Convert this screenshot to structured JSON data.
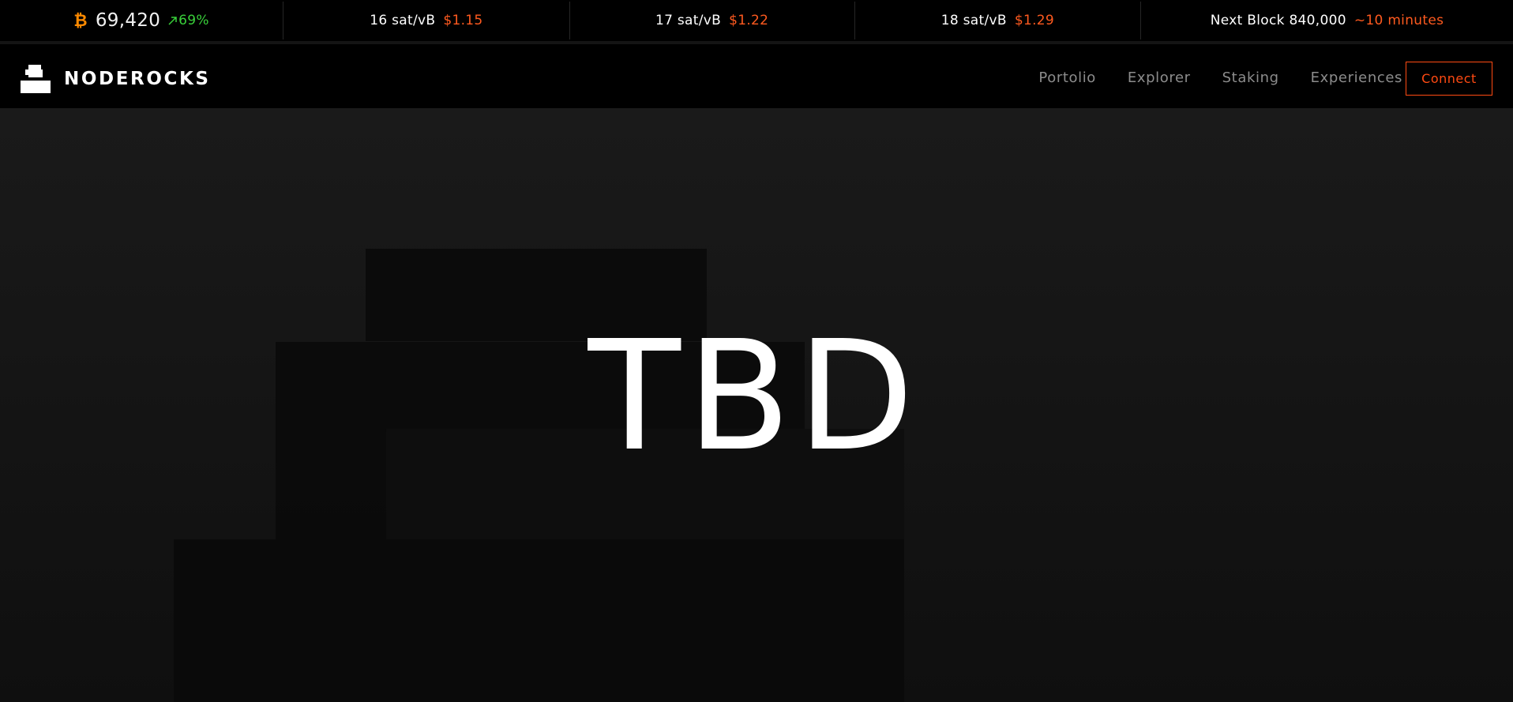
{
  "ticker": {
    "btc": {
      "icon": "bitcoin-icon",
      "symbol": "₿",
      "price": "69,420",
      "change": "69%",
      "change_icon": "arrow-up-right-icon"
    },
    "fees": [
      {
        "rate": "16 sat/vB",
        "usd": "$1.15"
      },
      {
        "rate": "17 sat/vB",
        "usd": "$1.22"
      },
      {
        "rate": "18 sat/vB",
        "usd": "$1.29"
      }
    ],
    "next_block": {
      "label": "Next Block 840,000",
      "eta": "~10 minutes"
    }
  },
  "nav": {
    "brand": "NODEROCKS",
    "logo_icon": "noderocks-logo-icon",
    "links": [
      "Portolio",
      "Explorer",
      "Staking",
      "Experiences"
    ],
    "connect_label": "Connect"
  },
  "hero": {
    "title": "TBD"
  },
  "colors": {
    "accent": "#ff4a12",
    "bitcoin": "#ff8a00",
    "positive": "#39d13a",
    "background": "#000000",
    "hero_background": "#161616"
  }
}
